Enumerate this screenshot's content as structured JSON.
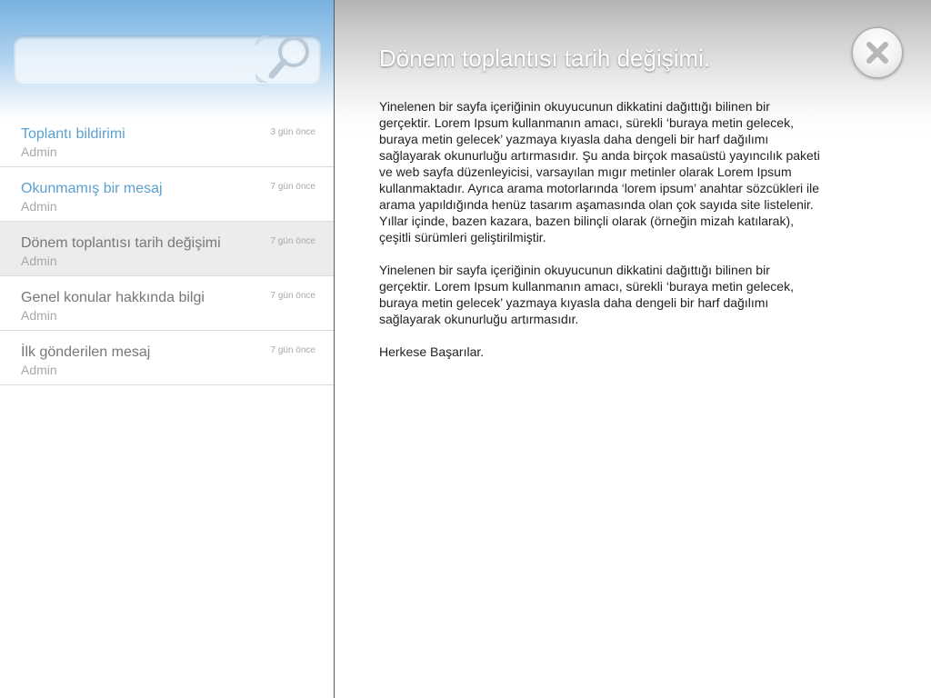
{
  "search": {
    "value": "",
    "placeholder": ""
  },
  "messages": [
    {
      "subject": "Toplantı bildirimi",
      "author": "Admin",
      "time": "3 gün önce",
      "unread": true,
      "selected": false
    },
    {
      "subject": "Okunmamış bir mesaj",
      "author": "Admin",
      "time": "7 gün önce",
      "unread": true,
      "selected": false
    },
    {
      "subject": "Dönem toplantısı tarih değişimi",
      "author": "Admin",
      "time": "7 gün önce",
      "unread": false,
      "selected": true
    },
    {
      "subject": "Genel konular hakkında bilgi",
      "author": "Admin",
      "time": "7 gün önce",
      "unread": false,
      "selected": false
    },
    {
      "subject": "İlk gönderilen mesaj",
      "author": "Admin",
      "time": "7 gün önce",
      "unread": false,
      "selected": false
    }
  ],
  "detail": {
    "title": "Dönem toplantısı tarih değişimi.",
    "paragraphs": [
      "Yinelenen bir sayfa içeriğinin okuyucunun dikkatini dağıttığı bilinen bir gerçektir. Lorem Ipsum kullanmanın amacı, sürekli ‘buraya metin gelecek, buraya metin gelecek’ yazmaya kıyasla daha dengeli bir harf dağılımı sağlayarak okunurluğu artırmasıdır. Şu anda birçok masaüstü yayıncılık paketi ve web sayfa düzenleyicisi, varsayılan mıgır metinler olarak Lorem Ipsum kullanmaktadır. Ayrıca arama motorlarında ‘lorem ipsum’ anahtar sözcükleri ile arama yapıldığında henüz tasarım aşamasında olan çok sayıda site listelenir. Yıllar içinde, bazen kazara, bazen bilinçli olarak (örneğin mizah katılarak), çeşitli sürümleri geliştirilmiştir.",
      "Yinelenen bir sayfa içeriğinin okuyucunun dikkatini dağıttığı bilinen bir gerçektir. Lorem Ipsum kullanmanın amacı, sürekli ‘buraya metin gelecek, buraya metin gelecek’ yazmaya kıyasla daha dengeli bir harf dağılımı sağlayarak okunurluğu artırmasıdır.",
      "Herkese Başarılar."
    ]
  },
  "icons": {
    "search": "search-icon",
    "close": "close-icon"
  },
  "colors": {
    "header_blue": "#78b2e0",
    "unread_subject": "#5b9fcf",
    "read_subject": "#777777",
    "selected_row": "#ececec"
  }
}
